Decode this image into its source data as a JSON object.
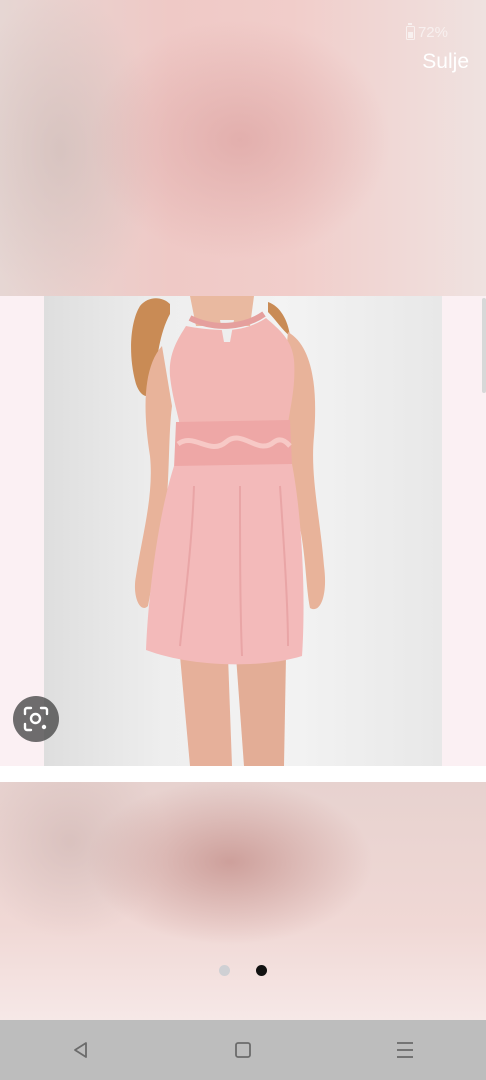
{
  "status_bar": {
    "battery_percent": "72%",
    "battery_icon": "battery-icon"
  },
  "viewer": {
    "close_label": "Sulje",
    "lens_icon": "lens-search-icon",
    "page_dots": {
      "count": 2,
      "active_index": 1
    }
  },
  "navigation_bar": {
    "back_icon": "back-triangle-icon",
    "home_icon": "home-square-icon",
    "recents_icon": "recents-menu-icon"
  },
  "colors": {
    "dress_pink": "#f0b5b5",
    "nav_bar": "#bdbdbd",
    "active_dot": "#111111"
  }
}
